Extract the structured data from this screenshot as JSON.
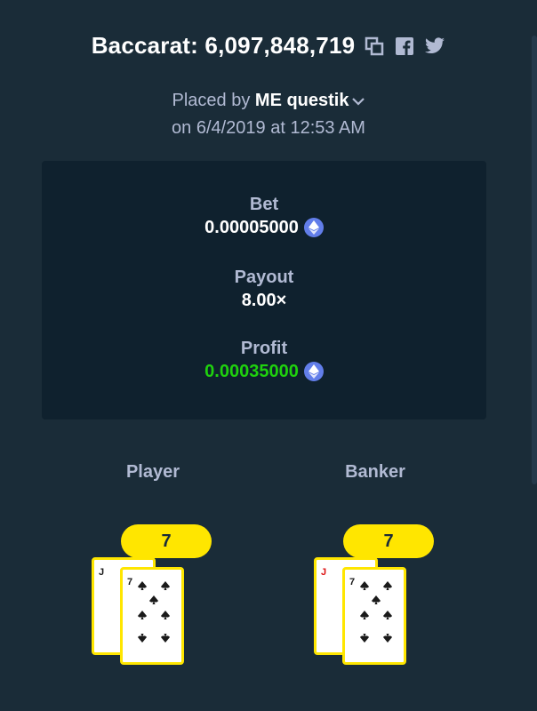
{
  "header": {
    "title": "Baccarat: 6,097,848,719",
    "icons": [
      "copy-icon",
      "facebook-icon",
      "twitter-icon"
    ]
  },
  "meta": {
    "placed_by_prefix": "Placed by",
    "user_badge": "ME",
    "username": "questik",
    "date_line": "on 6/4/2019 at 12:53 AM"
  },
  "stats": {
    "bet_label": "Bet",
    "bet_value": "0.00005000",
    "payout_label": "Payout",
    "payout_value": "8.00×",
    "profit_label": "Profit",
    "profit_value": "0.00035000",
    "currency_icon": "eth-icon"
  },
  "hands": {
    "player": {
      "label": "Player",
      "score": "7",
      "cards": [
        "J",
        "7"
      ]
    },
    "banker": {
      "label": "Banker",
      "score": "7",
      "cards": [
        "J",
        "7"
      ]
    }
  },
  "colors": {
    "background": "#1a2c38",
    "panel": "#0f212e",
    "accent": "#ffe600",
    "profit": "#1fd10e",
    "muted": "#b1bad3",
    "eth": "#627eea"
  }
}
